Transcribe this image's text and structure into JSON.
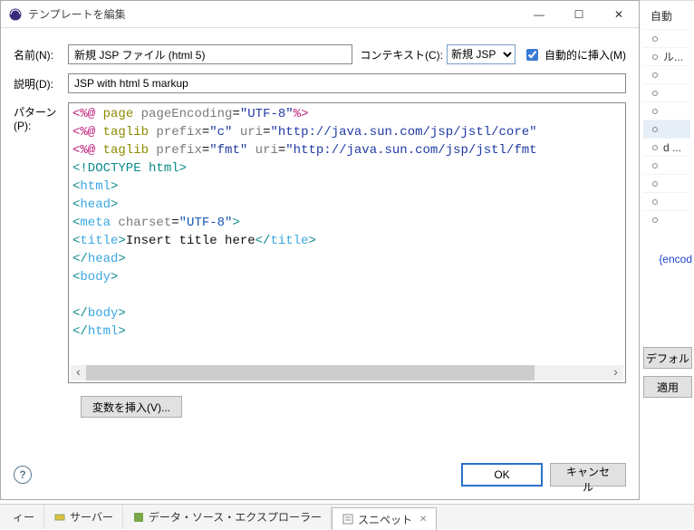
{
  "window": {
    "title": "テンプレートを編集",
    "minimize": "—",
    "maximize": "☐",
    "close": "✕"
  },
  "labels": {
    "name": "名前(N):",
    "context": "コンテキスト(C):",
    "auto_insert": "自動的に挿入(M)",
    "description": "説明(D):",
    "pattern": "パターン(P):",
    "insert_var": "変数を挿入(V)...",
    "ok": "OK",
    "cancel": "キャンセル"
  },
  "values": {
    "name": "新規 JSP ファイル (html 5)",
    "context_selected": "新規 JSP",
    "auto_insert_checked": true,
    "description": "JSP with html 5 markup"
  },
  "scroll": {
    "left": "‹",
    "right": "›"
  },
  "code": {
    "l1": {
      "a": "<%@",
      "b": " page",
      "c": " pageEncoding",
      "d": "=",
      "e": "\"UTF-8\"",
      "f": "%>"
    },
    "l2": {
      "a": "<%@",
      "b": " taglib",
      "c": " prefix",
      "d": "=",
      "e": "\"c\"",
      "f": " uri",
      "g": "=",
      "h": "\"http://java.sun.com/jsp/jstl/core\""
    },
    "l3": {
      "a": "<%@",
      "b": " taglib",
      "c": " prefix",
      "d": "=",
      "e": "\"fmt\"",
      "f": " uri",
      "g": "=",
      "h": "\"http://java.sun.com/jsp/jstl/fmt"
    },
    "l4": "<!DOCTYPE html>",
    "l5": {
      "a": "<",
      "b": "html",
      "c": ">"
    },
    "l6": {
      "a": "<",
      "b": "head",
      "c": ">"
    },
    "l7": {
      "a": "<",
      "b": "meta",
      "c": " charset",
      "d": "=",
      "e": "\"UTF-8\"",
      "f": ">"
    },
    "l8": {
      "a": "<",
      "b": "title",
      "c": ">",
      "d": "Insert title here",
      "e": "</",
      "f": "title",
      "g": ">"
    },
    "l9": {
      "a": "</",
      "b": "head",
      "c": ">"
    },
    "l10": {
      "a": "<",
      "b": "body",
      "c": ">"
    },
    "l11": {
      "a": "</",
      "b": "body",
      "c": ">"
    },
    "l12": {
      "a": "</",
      "b": "html",
      "c": ">"
    }
  },
  "right_panel": {
    "header": "自動",
    "item_partial": "ル...",
    "item_d": "d ...",
    "encoding_link": "{encod",
    "btn_default": "デフォル",
    "btn_apply": "適用"
  },
  "tabs": {
    "t0": "ィー",
    "t1": "サーバー",
    "t2": "データ・ソース・エクスプローラー",
    "t3": "スニペット"
  }
}
